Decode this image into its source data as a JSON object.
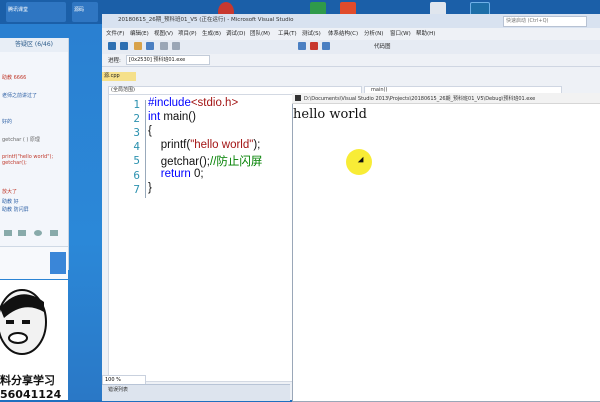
{
  "taskbar": {
    "items": [
      "腾讯课堂",
      "源码",
      "Wireshark"
    ],
    "right_search_placeholder": "快速启动 (Ctrl+Q)"
  },
  "chat": {
    "header": "答疑区 (6/46)",
    "messages": [
      "助教 6666",
      "老师之前讲过了",
      "好的",
      "getchar ( ) 原理",
      "printf(\"hello world\"); getchar();",
      "放大了",
      "助教 好",
      "助教 防闪屏"
    ],
    "brand_line1": "料分享学习",
    "brand_line2": "56041124"
  },
  "vs": {
    "title": "20180615_26期_预科班01_V5 (正在运行) - Microsoft Visual Studio",
    "menu": [
      "文件(F)",
      "编辑(E)",
      "视图(V)",
      "项目(P)",
      "生成(B)",
      "调试(D)",
      "团队(M)",
      "工具(T)",
      "测试(S)",
      "体系结构(C)",
      "分析(N)",
      "窗口(W)",
      "帮助(H)"
    ],
    "toolbar_label": "代码图",
    "process_label": "进程:",
    "process_value": "[0x2530] 预科班01.exe",
    "file_tab": "源.cpp",
    "nav_left": "(全局范围)",
    "nav_right": "main()",
    "zoom": "100 %",
    "output_panel_title": "错误列表",
    "code_lines": [
      {
        "n": "1",
        "parts": [
          {
            "t": "#include",
            "c": "kw"
          },
          {
            "t": "<stdio.h>",
            "c": "str"
          }
        ]
      },
      {
        "n": "2",
        "parts": [
          {
            "t": "int ",
            "c": "kw"
          },
          {
            "t": "main()",
            "c": ""
          }
        ]
      },
      {
        "n": "3",
        "parts": [
          {
            "t": "{",
            "c": ""
          }
        ]
      },
      {
        "n": "4",
        "parts": [
          {
            "t": "    printf(",
            "c": ""
          },
          {
            "t": "\"hello world\"",
            "c": "str"
          },
          {
            "t": ");",
            "c": ""
          }
        ]
      },
      {
        "n": "5",
        "parts": [
          {
            "t": "    getchar();",
            "c": ""
          },
          {
            "t": "//防止闪屏",
            "c": "cm"
          }
        ]
      },
      {
        "n": "6",
        "parts": [
          {
            "t": "    ",
            "c": ""
          },
          {
            "t": "return ",
            "c": "kw"
          },
          {
            "t": "0;",
            "c": ""
          }
        ]
      },
      {
        "n": "7",
        "parts": [
          {
            "t": "}",
            "c": ""
          }
        ]
      }
    ]
  },
  "console": {
    "title": "D:\\Documents\\Visual Studio 2013\\Projects\\20180615_26期_预科班01_V5\\Debug\\预科班01.exe",
    "output": "hello world"
  },
  "colors": {
    "desktop": "#2b88d8",
    "keyword": "#0000ff",
    "string": "#a31515",
    "comment": "#008000",
    "line_number": "#2b91af",
    "cursor_highlight": "#f7ea20"
  }
}
